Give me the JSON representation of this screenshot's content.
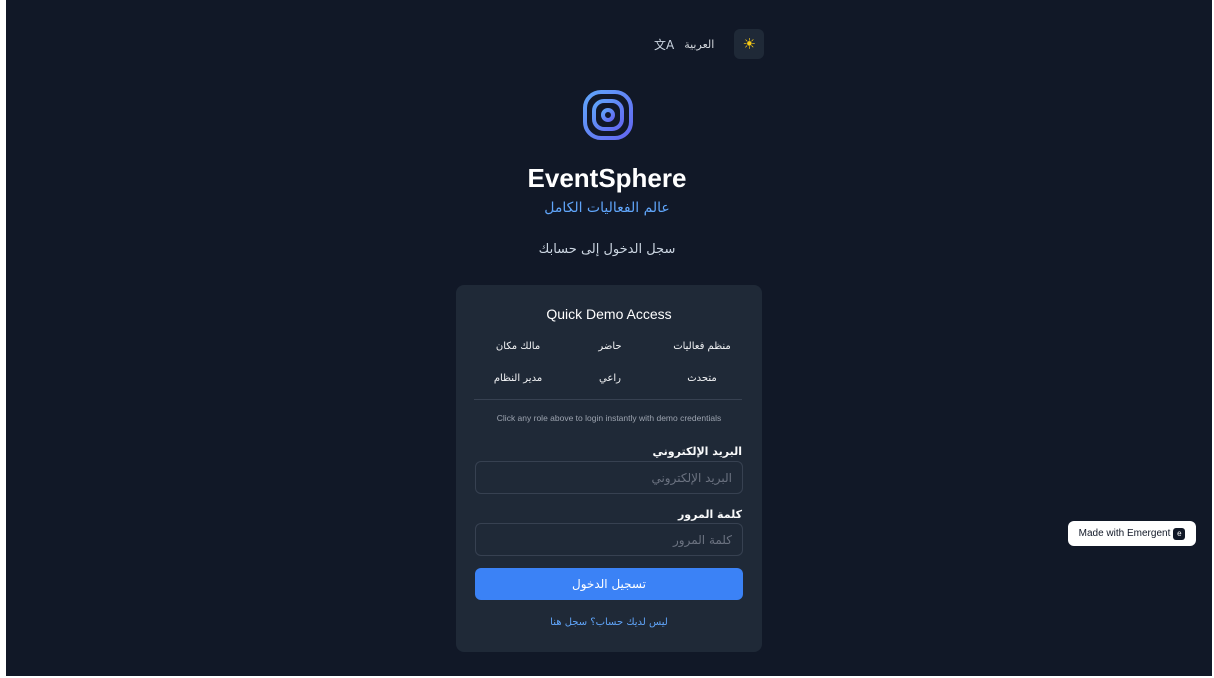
{
  "header": {
    "language_label": "العربية",
    "language_icon": "translate-icon",
    "theme_icon": "sun-icon"
  },
  "brand": {
    "logo_icon": "spiral-logo-icon",
    "title": "EventSphere",
    "tagline": "عالم الفعاليات الكامل",
    "subtitle": "سجل الدخول إلى حسابك"
  },
  "demo": {
    "title": "Quick Demo Access",
    "roles": [
      "منظم فعاليات",
      "حاضر",
      "مالك مكان",
      "متحدث",
      "راعي",
      "مدير النظام"
    ],
    "hint": "Click any role above to login instantly with demo credentials"
  },
  "form": {
    "email_label": "البريد الإلكتروني",
    "email_placeholder": "البريد الإلكتروني",
    "password_label": "كلمة المرور",
    "password_placeholder": "كلمة المرور",
    "submit_label": "تسجيل الدخول",
    "signup_link": "ليس لديك حساب؟ سجل هنا"
  },
  "badge": {
    "label": "Made with Emergent",
    "icon": "emergent-logo-icon"
  },
  "colors": {
    "background": "#111827",
    "card": "#1f2937",
    "accent": "#3b82f6",
    "link": "#60a5fa",
    "sun": "#facc15"
  }
}
